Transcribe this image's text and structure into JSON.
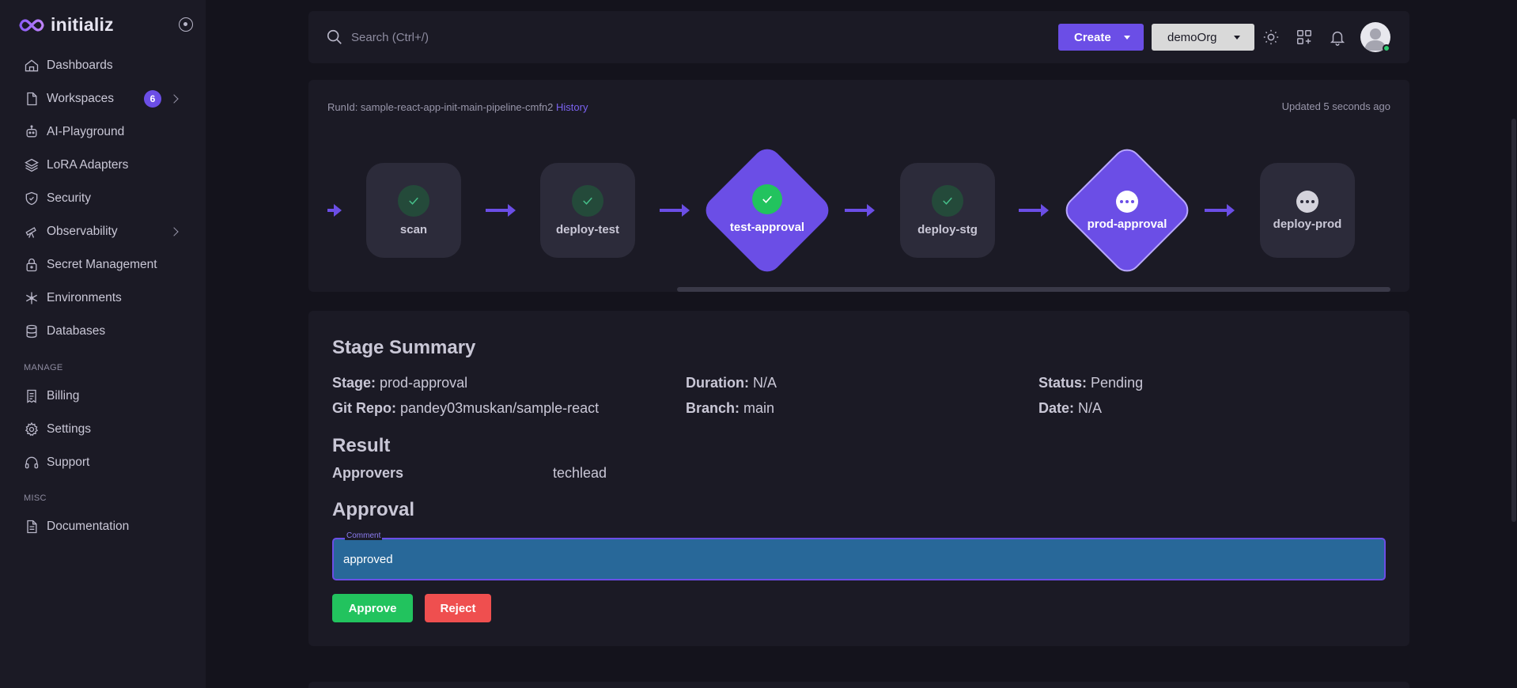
{
  "brand": {
    "name": "initializ"
  },
  "sidebar": {
    "items": [
      {
        "label": "Dashboards",
        "icon": "home-icon"
      },
      {
        "label": "Workspaces",
        "icon": "file-icon",
        "badge": "6"
      },
      {
        "label": "AI-Playground",
        "icon": "robot-icon"
      },
      {
        "label": "LoRA Adapters",
        "icon": "layers-icon"
      },
      {
        "label": "Security",
        "icon": "shield-icon"
      },
      {
        "label": "Observability",
        "icon": "telescope-icon"
      },
      {
        "label": "Secret Management",
        "icon": "lock-icon"
      },
      {
        "label": "Environments",
        "icon": "snowflake-icon"
      },
      {
        "label": "Databases",
        "icon": "database-icon"
      }
    ],
    "manage_label": "MANAGE",
    "manage_items": [
      {
        "label": "Billing",
        "icon": "receipt-icon"
      },
      {
        "label": "Settings",
        "icon": "gear-icon"
      },
      {
        "label": "Support",
        "icon": "headphones-icon"
      }
    ],
    "misc_label": "MISC",
    "misc_items": [
      {
        "label": "Documentation",
        "icon": "document-icon"
      }
    ]
  },
  "header": {
    "search_placeholder": "Search (Ctrl+/)",
    "create_label": "Create",
    "org_label": "demoOrg"
  },
  "pipeline": {
    "run_id_text": "RunId: sample-react-app-init-main-pipeline-cmfn2",
    "history_label": "History",
    "updated_text": "Updated 5 seconds ago",
    "stages": [
      {
        "name": "scan",
        "status": "success"
      },
      {
        "name": "deploy-test",
        "status": "success"
      },
      {
        "name": "test-approval",
        "status": "success"
      },
      {
        "name": "deploy-stg",
        "status": "success"
      },
      {
        "name": "prod-approval",
        "status": "pending"
      },
      {
        "name": "deploy-prod",
        "status": "pending"
      }
    ]
  },
  "summary": {
    "title": "Stage Summary",
    "stage_label": "Stage:",
    "stage_value": "prod-approval",
    "duration_label": "Duration:",
    "duration_value": "N/A",
    "status_label": "Status:",
    "status_value": "Pending",
    "repo_label": "Git Repo:",
    "repo_value": "pandey03muskan/sample-react",
    "branch_label": "Branch:",
    "branch_value": "main",
    "date_label": "Date:",
    "date_value": "N/A",
    "result_title": "Result",
    "approvers_label": "Approvers",
    "approvers_value": "techlead",
    "approval_title": "Approval",
    "comment_label": "Comment",
    "comment_value": "approved",
    "approve_label": "Approve",
    "reject_label": "Reject"
  },
  "colors": {
    "accent": "#6b4ee6",
    "success": "#22c35e",
    "danger": "#ef4f4f",
    "input_bg": "#286899"
  }
}
